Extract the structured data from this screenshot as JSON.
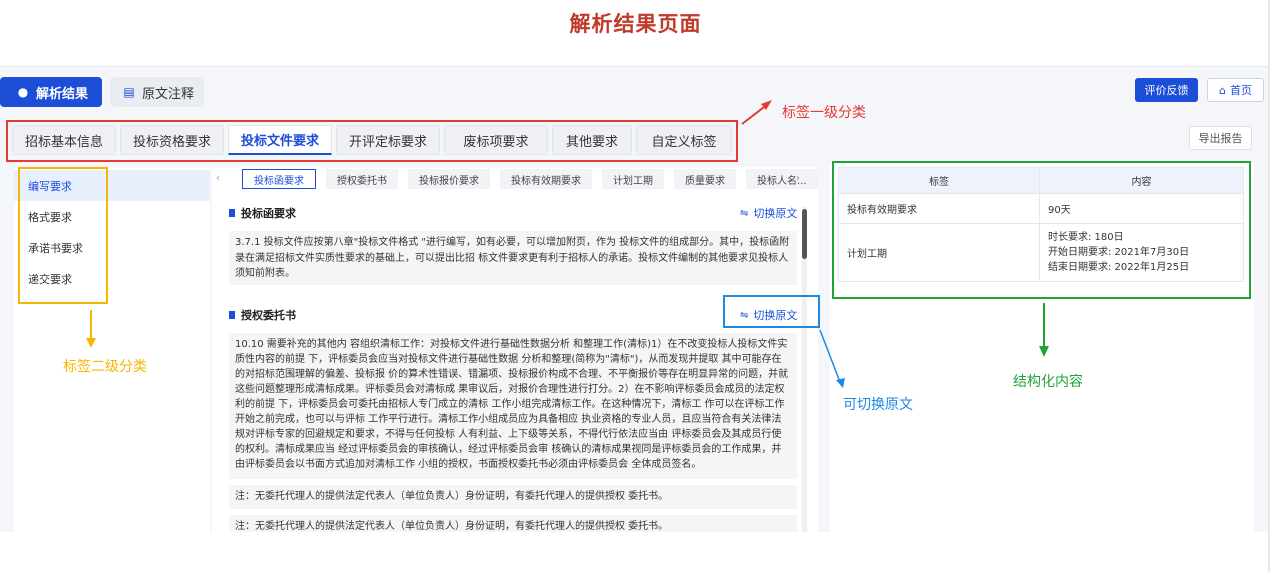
{
  "page_title": "解析结果页面",
  "top_tabs": {
    "active": "解析结果",
    "other": "原文注释"
  },
  "buttons": {
    "feedback": "评价反馈",
    "home": "首页",
    "export": "导出报告",
    "switch_label": "切换原文"
  },
  "categories": [
    "招标基本信息",
    "投标资格要求",
    "投标文件要求",
    "开评定标要求",
    "废标项要求",
    "其他要求",
    "自定义标签"
  ],
  "selected_category": "投标文件要求",
  "sub_categories": [
    "编写要求",
    "格式要求",
    "承诺书要求",
    "递交要求"
  ],
  "chips": [
    "投标函要求",
    "授权委托书",
    "投标报价要求",
    "投标有效期要求",
    "计划工期",
    "质量要求",
    "投标人名..."
  ],
  "sections": [
    {
      "title": "投标函要求",
      "text": "3.7.1 投标文件应按第八章\"投标文件格式 \"进行编写，如有必要，可以增加附页，作为 投标文件的组成部分。其中，投标函附录在满足招标文件实质性要求的基础上，可以提出比招 标文件要求更有利于招标人的承诺。投标文件编制的其他要求见投标人须知前附表。"
    },
    {
      "title": "授权委托书",
      "text": "10.10 需要补充的其他内 容组织清标工作：对投标文件进行基础性数据分析 和整理工作(清标)1）在不改变投标人投标文件实质性内容的前提 下，评标委员会应当对投标文件进行基础性数据 分析和整理(简称为\"清标\")，从而发现并提取 其中可能存在的对招标范围理解的偏差、投标报 价的算术性错误、错漏项、投标报价构成不合理、不平衡报价等存在明显异常的问题，并就这些问题整理形成清标成果。评标委员会对清标成 果审议后，对报价合理性进行打分。2）在不影响评标委员会成员的法定权利的前提 下，评标委员会可委托由招标人专门成立的清标 工作小组完成清标工作。在这种情况下，清标工 作可以在评标工作开始之前完成，也可以与评标 工作平行进行。清标工作小组成员应为具备相应 执业资格的专业人员，且应当符合有关法律法规对评标专家的回避规定和要求，不得与任何投标 人有利益、上下级等关系，不得代行依法应当由 评标委员会及其成员行使的权利。清标成果应当 经过评标委员会的审核确认，经过评标委员会审 核确认的清标成果视同是评标委员会的工作成果，并由评标委员会以书面方式追加对清标工作 小组的授权，书面授权委托书必须由评标委员会 全体成员签名。"
    }
  ],
  "notes": [
    "注：无委托代理人的提供法定代表人（单位负责人）身份证明，有委托代理人的提供授权 委托书。",
    "注：无委托代理人的提供法定代表人（单位负责人）身份证明，有委托代理人的提供授权 委托书。"
  ],
  "table": {
    "headers": [
      "标签",
      "内容"
    ],
    "rows": [
      {
        "label": "投标有效期要求",
        "lines": [
          "90天"
        ]
      },
      {
        "label": "计划工期",
        "lines": [
          "时长要求: 180日",
          "开始日期要求: 2021年7月30日",
          "结束日期要求: 2022年1月25日"
        ]
      }
    ]
  },
  "annotations": {
    "level1": "标签一级分类",
    "level2": "标签二级分类",
    "switch": "可切换原文",
    "structured": "结构化内容",
    "colors": {
      "red": "#e53935",
      "yellow": "#f5b800",
      "blue": "#1e88e5",
      "green": "#22a33a"
    }
  }
}
